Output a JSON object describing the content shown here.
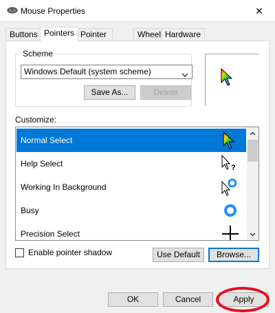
{
  "window": {
    "title": "Mouse Properties",
    "close_glyph": "✕"
  },
  "tabs": [
    {
      "label": "Buttons"
    },
    {
      "label": "Pointers"
    },
    {
      "label": "Pointer Options"
    },
    {
      "label": "Wheel"
    },
    {
      "label": "Hardware"
    }
  ],
  "scheme": {
    "legend": "Scheme",
    "selected": "Windows Default (system scheme)",
    "save_as_label": "Save As...",
    "delete_label": "Delete"
  },
  "customize": {
    "label": "Customize:",
    "items": [
      {
        "label": "Normal Select",
        "icon": "rainbow-arrow-icon",
        "selected": true
      },
      {
        "label": "Help Select",
        "icon": "help-select-icon"
      },
      {
        "label": "Working In Background",
        "icon": "working-background-icon"
      },
      {
        "label": "Busy",
        "icon": "busy-ring-icon"
      },
      {
        "label": "Precision Select",
        "icon": "crosshair-icon"
      }
    ]
  },
  "options": {
    "shadow_label": "Enable pointer shadow",
    "shadow_checked": false,
    "use_default_label": "Use Default",
    "browse_label": "Browse..."
  },
  "footer": {
    "ok_label": "OK",
    "cancel_label": "Cancel",
    "apply_label": "Apply"
  },
  "colors": {
    "selection": "#0078d7",
    "annotation": "#e4101e"
  }
}
